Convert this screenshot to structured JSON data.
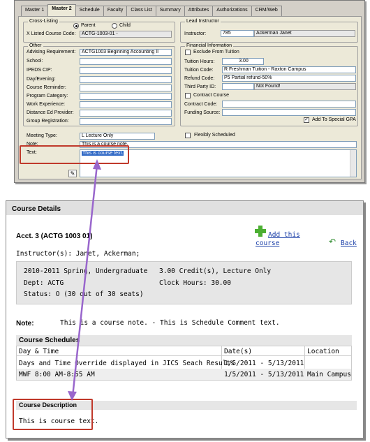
{
  "app": {
    "tabs": [
      "Master 1",
      "Master 2",
      "Schedule",
      "Faculty",
      "Class List",
      "Summary",
      "Attributes",
      "Authorizations",
      "CRM/Web"
    ],
    "cross_listing": {
      "title": "Cross-Listing",
      "parent": "Parent",
      "child": "Child",
      "x_listed_label": "X Listed Course Code:",
      "x_listed_value": "ACTG-1003-01 -"
    },
    "lead_instructor": {
      "title": "Lead Instructor",
      "label": "Instructor:",
      "id": "785",
      "name": "Ackerman Janet"
    },
    "other": {
      "title": "Other",
      "fields": [
        {
          "label": "Advising Requirement:",
          "value": "ACTG1003  Beginning Accounting II"
        },
        {
          "label": "School:",
          "value": ""
        },
        {
          "label": "IPEDS CIP:",
          "value": ""
        },
        {
          "label": "Day/Evening:",
          "value": ""
        },
        {
          "label": "Course Reminder:",
          "value": ""
        },
        {
          "label": "Program Category:",
          "value": ""
        },
        {
          "label": "Work Experience:",
          "value": ""
        },
        {
          "label": "Distance Ed Provider:",
          "value": ""
        },
        {
          "label": "Group Registration:",
          "value": ""
        }
      ]
    },
    "financial": {
      "title": "Financial Information",
      "exclude": "Exclude From Tuition",
      "tuition_hours_label": "Tuition Hours:",
      "tuition_hours": "3.00",
      "tuition_code_label": "Tuition Code:",
      "tuition_code": "R   Freshman Tuition - Raxton Campus",
      "refund_code_label": "Refund Code:",
      "refund_code": "P5  Partial refund-50%",
      "third_party_label": "Third Party ID:",
      "third_party_status": "Not Found!",
      "contract_course": "Contract Course",
      "contract_code_label": "Contract Code:",
      "funding_source_label": "Funding Source:",
      "special_gpa": "Add To Special GPA"
    },
    "meeting_type_label": "Meeting Type:",
    "meeting_type": "L   Lecture Only",
    "flexibly": "Flexibly Scheduled",
    "note_label": "Note:",
    "note_value": "This is a course note.",
    "text_label": "Text:",
    "text_value": "This is course text."
  },
  "web": {
    "title": "Course Details",
    "course": "Acct. 3 (ACTG 1003 01)",
    "add_link": "Add this course",
    "back_link": "Back",
    "instructors": "Instructor(s): Janet, Ackerman;",
    "term": "2010-2011 Spring, Undergraduate",
    "credits": "3.00 Credit(s), Lecture Only",
    "dept": "Dept: ACTG",
    "clock_hours": "Clock Hours: 30.00",
    "status": "Status: O (30 out of 30 seats)",
    "note_label": "Note:",
    "note_text": "This is a course note. - This is Schedule Comment text.",
    "schedules_title": "Course Schedules",
    "columns": [
      "Day & Time",
      "Date(s)",
      "Location"
    ],
    "rows": [
      [
        "Days and Time Override displayed in JICS Seach Results",
        "1/5/2011 - 5/13/2011",
        ""
      ],
      [
        "MWF 8:00 AM-8:55 AM",
        "1/5/2011 - 5/13/2011",
        "Main Campus"
      ]
    ],
    "description_title": "Course Description",
    "description": "This is course text."
  },
  "colors": {
    "accent_arrow": "#9966cc",
    "callout": "#c0392b",
    "link": "#1a3fa8"
  }
}
